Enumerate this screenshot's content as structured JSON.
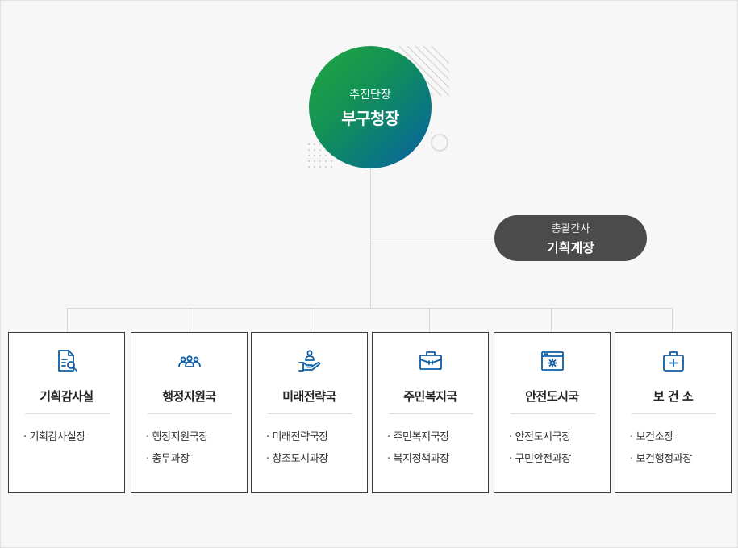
{
  "head": {
    "subtitle": "추진단장",
    "title": "부구청장"
  },
  "advisor": {
    "subtitle": "총괄간사",
    "title": "기획계장"
  },
  "colors": {
    "icon": "#0d5ea6",
    "pill": "#4b4b4b",
    "head_start": "#21a63e",
    "head_end": "#0d5ea6"
  },
  "departments": [
    {
      "icon": "document-search-icon",
      "title": "기획감사실",
      "items": [
        "· 기획감사실장"
      ]
    },
    {
      "icon": "people-group-icon",
      "title": "행정지원국",
      "items": [
        "· 행정지원국장",
        "· 총무과장"
      ]
    },
    {
      "icon": "hand-person-icon",
      "title": "미래전략국",
      "items": [
        "· 미래전략국장",
        "· 창조도시과장"
      ]
    },
    {
      "icon": "briefcase-icon",
      "title": "주민복지국",
      "items": [
        "· 주민복지국장",
        "· 복지정책과장"
      ]
    },
    {
      "icon": "browser-gear-icon",
      "title": "안전도시국",
      "items": [
        "· 안전도시국장",
        "· 구민안전과장"
      ]
    },
    {
      "icon": "first-aid-kit-icon",
      "title": "보 건 소",
      "items": [
        "· 보건소장",
        "· 보건행정과장"
      ]
    }
  ]
}
